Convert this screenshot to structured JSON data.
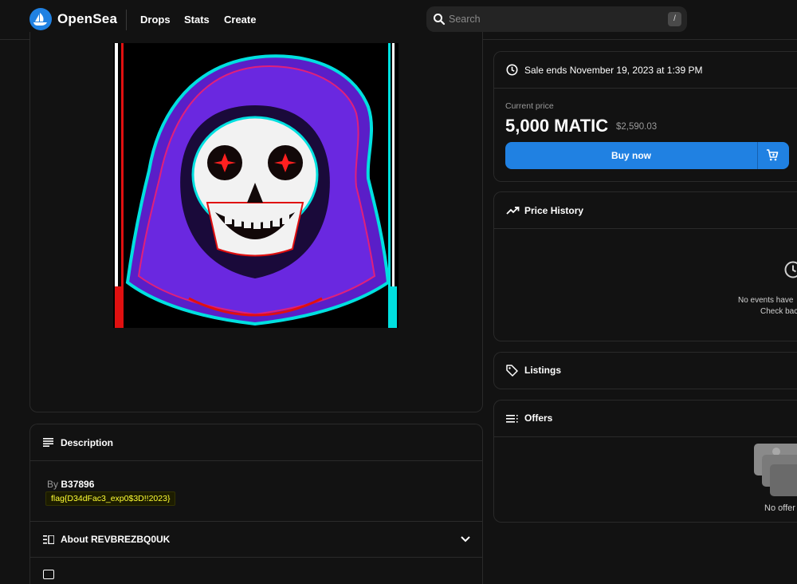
{
  "header": {
    "brand": "OpenSea",
    "nav": [
      "Drops",
      "Stats",
      "Create"
    ],
    "search_placeholder": "Search",
    "search_shortcut": "/"
  },
  "sale": {
    "ends_text": "Sale ends November 19, 2023 at 1:39 PM",
    "current_price_label": "Current price",
    "price": "5,000 MATIC",
    "usd_price": "$2,590.03",
    "buy_label": "Buy now"
  },
  "price_history": {
    "title": "Price History",
    "empty_line1": "No events have",
    "empty_line2": "Check bac"
  },
  "listings": {
    "title": "Listings"
  },
  "offers": {
    "title": "Offers",
    "empty": "No offer"
  },
  "description": {
    "title": "Description",
    "by_label": "By",
    "creator": "B37896",
    "text": "flag{D34dFac3_exp0$3D!!2023}"
  },
  "about": {
    "title": "About REVBREZBQ0UK"
  },
  "colors": {
    "accent": "#2081e2",
    "background": "#121212",
    "flag_text": "#ffff33"
  }
}
